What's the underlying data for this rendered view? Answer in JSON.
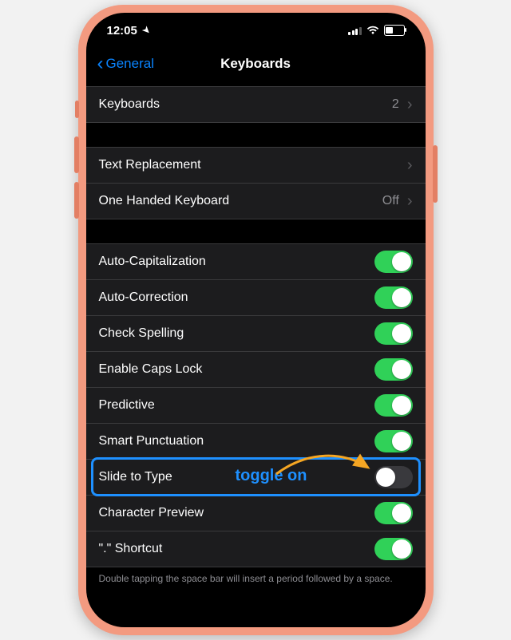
{
  "status": {
    "time": "12:05"
  },
  "nav": {
    "back_label": "General",
    "title": "Keyboards"
  },
  "group1": {
    "keyboards_label": "Keyboards",
    "keyboards_value": "2"
  },
  "group2": {
    "text_replacement_label": "Text Replacement",
    "one_handed_label": "One Handed Keyboard",
    "one_handed_value": "Off"
  },
  "group3": {
    "items": [
      {
        "label": "Auto-Capitalization",
        "on": true
      },
      {
        "label": "Auto-Correction",
        "on": true
      },
      {
        "label": "Check Spelling",
        "on": true
      },
      {
        "label": "Enable Caps Lock",
        "on": true
      },
      {
        "label": "Predictive",
        "on": true
      },
      {
        "label": "Smart Punctuation",
        "on": true
      },
      {
        "label": "Slide to Type",
        "on": false
      },
      {
        "label": "Character Preview",
        "on": true
      },
      {
        "label": "\".\" Shortcut",
        "on": true
      }
    ],
    "footer": "Double tapping the space bar will insert a period followed by a space."
  },
  "annotation": {
    "text": "toggle on"
  }
}
